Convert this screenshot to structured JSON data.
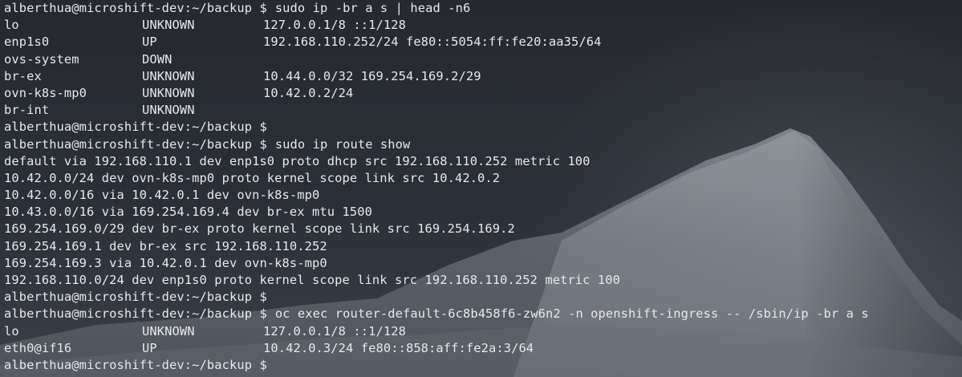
{
  "prompt": "alberthua@microshift-dev:~/backup $",
  "blocks": [
    {
      "type": "cmd",
      "text": "sudo ip -br a s | head -n6"
    },
    {
      "type": "row",
      "cols": [
        "lo",
        "UNKNOWN",
        "127.0.0.1/8 ::1/128"
      ]
    },
    {
      "type": "row",
      "cols": [
        "enp1s0",
        "UP",
        "192.168.110.252/24 fe80::5054:ff:fe20:aa35/64"
      ]
    },
    {
      "type": "row",
      "cols": [
        "ovs-system",
        "DOWN",
        ""
      ]
    },
    {
      "type": "row",
      "cols": [
        "br-ex",
        "UNKNOWN",
        "10.44.0.0/32 169.254.169.2/29"
      ]
    },
    {
      "type": "row",
      "cols": [
        "ovn-k8s-mp0",
        "UNKNOWN",
        "10.42.0.2/24"
      ]
    },
    {
      "type": "row",
      "cols": [
        "br-int",
        "UNKNOWN",
        ""
      ]
    },
    {
      "type": "cmd",
      "text": ""
    },
    {
      "type": "cmd",
      "text": "sudo ip route show"
    },
    {
      "type": "text",
      "text": "default via 192.168.110.1 dev enp1s0 proto dhcp src 192.168.110.252 metric 100"
    },
    {
      "type": "text",
      "text": "10.42.0.0/24 dev ovn-k8s-mp0 proto kernel scope link src 10.42.0.2"
    },
    {
      "type": "text",
      "text": "10.42.0.0/16 via 10.42.0.1 dev ovn-k8s-mp0"
    },
    {
      "type": "text",
      "text": "10.43.0.0/16 via 169.254.169.4 dev br-ex mtu 1500"
    },
    {
      "type": "text",
      "text": "169.254.169.0/29 dev br-ex proto kernel scope link src 169.254.169.2"
    },
    {
      "type": "text",
      "text": "169.254.169.1 dev br-ex src 192.168.110.252"
    },
    {
      "type": "text",
      "text": "169.254.169.3 via 10.42.0.1 dev ovn-k8s-mp0"
    },
    {
      "type": "text",
      "text": "192.168.110.0/24 dev enp1s0 proto kernel scope link src 192.168.110.252 metric 100"
    },
    {
      "type": "cmd",
      "text": ""
    },
    {
      "type": "cmd",
      "text": "oc exec router-default-6c8b458f6-zw6n2 -n openshift-ingress -- /sbin/ip -br a s"
    },
    {
      "type": "row",
      "cols": [
        "lo",
        "UNKNOWN",
        "127.0.0.1/8 ::1/128"
      ]
    },
    {
      "type": "row",
      "cols": [
        "eth0@if16",
        "UP",
        "10.42.0.3/24 fe80::858:aff:fe2a:3/64"
      ]
    },
    {
      "type": "cmd",
      "text": ""
    }
  ]
}
